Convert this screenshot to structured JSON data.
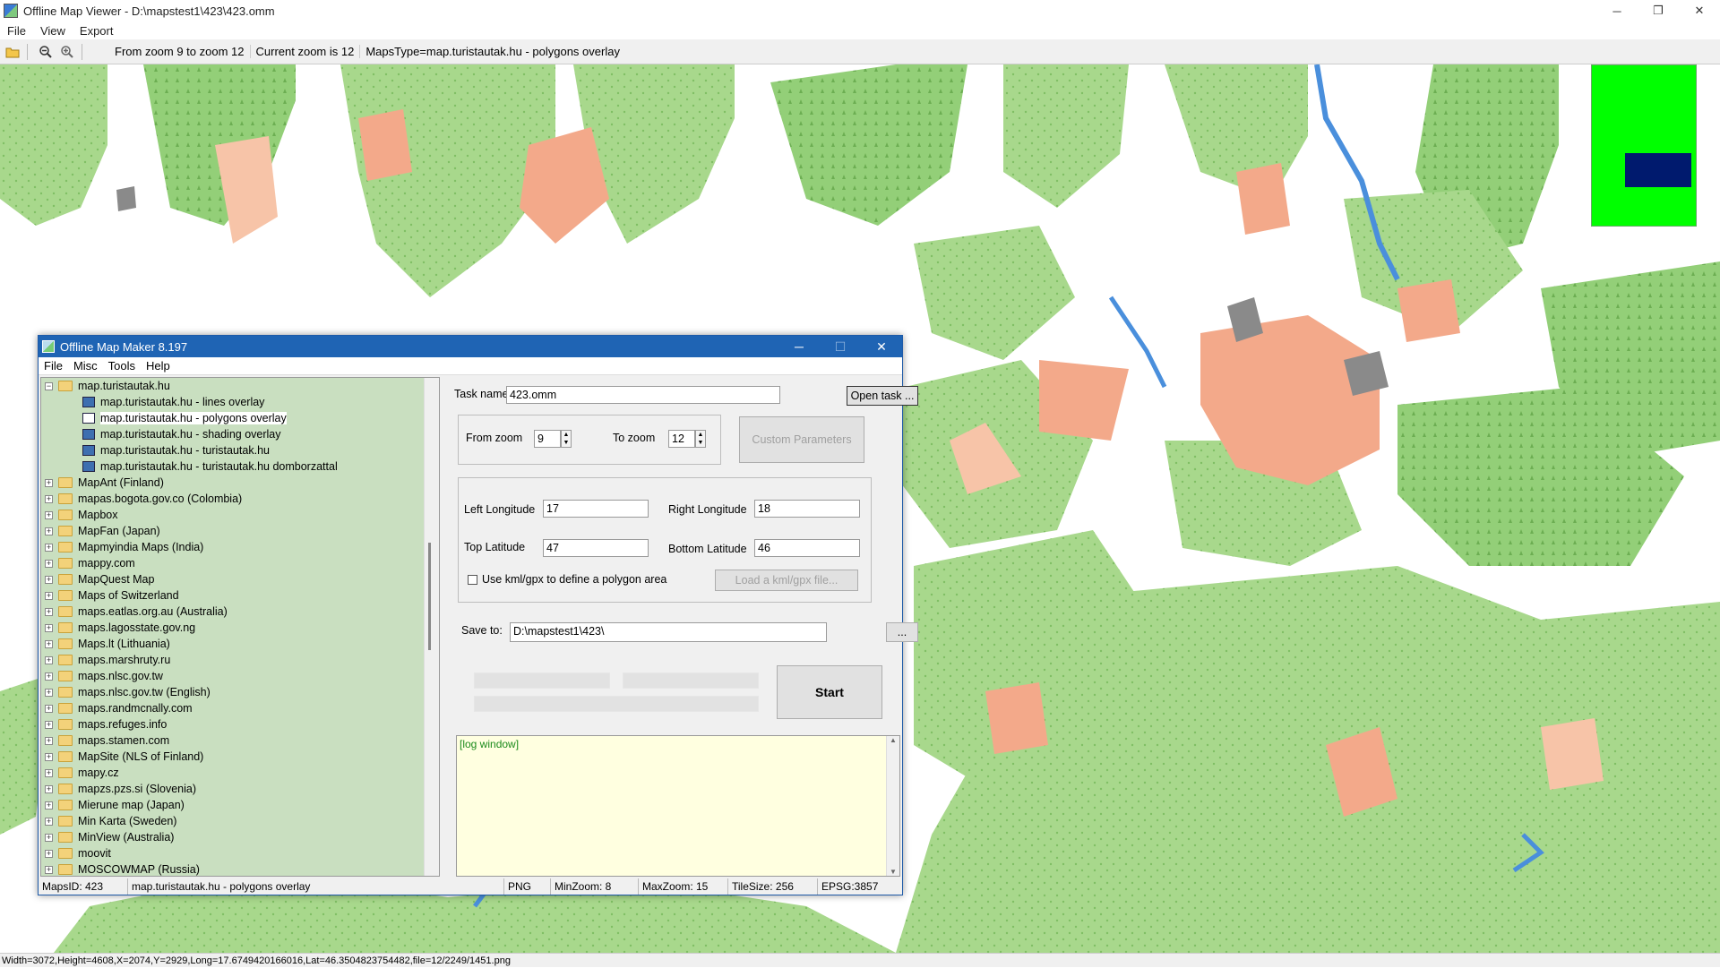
{
  "window": {
    "title": "Offline Map Viewer - D:\\mapstest1\\423\\423.omm",
    "controls": {
      "minimize": "─",
      "maximize": "❐",
      "close": "✕"
    }
  },
  "menu": [
    "File",
    "View",
    "Export"
  ],
  "toolbar": {
    "zoom_range": "From zoom 9 to zoom 12",
    "current_zoom": "Current zoom is 12",
    "maps_type": "MapsType=map.turistautak.hu - polygons overlay"
  },
  "map": {
    "colors": {
      "forest": "#a8d88c",
      "forest_dark": "#8cc76e",
      "urban": "#f3a98a",
      "urban_light": "#f7c4a8",
      "water": "#4a8fdc",
      "industrial": "#8a8a8a",
      "background": "#ffffff"
    },
    "minimap_colors": {
      "area": "#00ff00",
      "view": "#001a6e"
    }
  },
  "status": "Width=3072,Height=4608,X=2074,Y=2929,Long=17.6749420166016,Lat=46.3504823754482,file=12/2249/1451.png",
  "dialog": {
    "title": "Offline Map Maker 8.197",
    "controls": {
      "minimize": "─",
      "maximize": "☐",
      "close": "✕"
    },
    "menu": [
      "File",
      "Misc",
      "Tools",
      "Help"
    ],
    "tree": {
      "root": "map.turistautak.hu",
      "children": [
        "map.turistautak.hu - lines overlay",
        "map.turistautak.hu - polygons overlay",
        "map.turistautak.hu - shading overlay",
        "map.turistautak.hu - turistautak.hu",
        "map.turistautak.hu - turistautak.hu domborzattal"
      ],
      "selected_index": 1,
      "folders": [
        "MapAnt (Finland)",
        "mapas.bogota.gov.co (Colombia)",
        "Mapbox",
        "MapFan (Japan)",
        "Mapmyindia Maps (India)",
        "mappy.com",
        "MapQuest Map",
        "Maps of Switzerland",
        "maps.eatlas.org.au (Australia)",
        "maps.lagosstate.gov.ng",
        "Maps.lt (Lithuania)",
        "maps.marshruty.ru",
        "maps.nlsc.gov.tw",
        "maps.nlsc.gov.tw (English)",
        "maps.randmcnally.com",
        "maps.refuges.info",
        "maps.stamen.com",
        "MapSite (NLS of Finland)",
        "mapy.cz",
        "mapzs.pzs.si (Slovenia)",
        "Mierune map (Japan)",
        "Min Karta (Sweden)",
        "MinView (Australia)",
        "moovit",
        "MOSCOWMAP (Russia)"
      ]
    },
    "task_name_label": "Task name",
    "task_name": "423.omm",
    "open_task": "Open task ...",
    "from_zoom_label": "From zoom",
    "from_zoom": "9",
    "to_zoom_label": "To zoom",
    "to_zoom": "12",
    "custom_params": "Custom Parameters",
    "left_lon_label": "Left Longitude",
    "left_lon": "17",
    "right_lon_label": "Right Longitude",
    "right_lon": "18",
    "top_lat_label": "Top Latitude",
    "top_lat": "47",
    "bottom_lat_label": "Bottom Latitude",
    "bottom_lat": "46",
    "kml_label": "Use kml/gpx to define a polygon area",
    "load_kml": "Load a kml/gpx file...",
    "save_to_label": "Save to:",
    "save_to": "D:\\mapstest1\\423\\",
    "browse": "...",
    "start": "Start",
    "log": "[log window]",
    "status": {
      "maps_id": "MapsID: 423",
      "name": "map.turistautak.hu - polygons overlay",
      "format": "PNG",
      "min_zoom": "MinZoom: 8",
      "max_zoom": "MaxZoom: 15",
      "tile_size": "TileSize: 256",
      "epsg": "EPSG:3857"
    }
  }
}
